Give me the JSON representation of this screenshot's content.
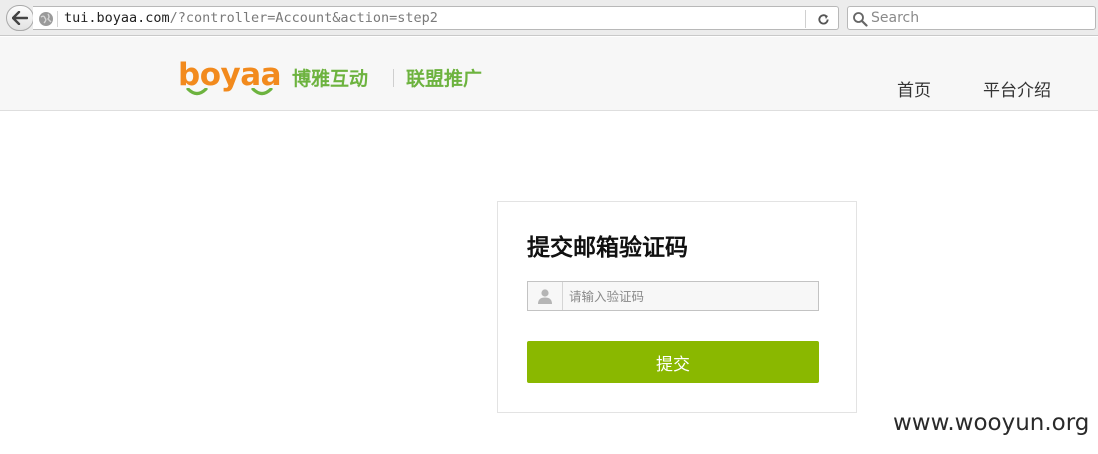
{
  "browser": {
    "url_host": "tui.boyaa.com",
    "url_path": "/?controller=Account&action=step2",
    "search_placeholder": "Search"
  },
  "header": {
    "logo_word": "boyaa",
    "logo_cn": "博雅互动",
    "logo_sub": "联盟推广",
    "nav": [
      "首页",
      "平台介绍"
    ]
  },
  "form": {
    "title": "提交邮箱验证码",
    "input_placeholder": "请输入验证码",
    "submit_label": "提交"
  },
  "watermark": "www.wooyun.org",
  "colors": {
    "brand_orange": "#f28a1d",
    "brand_green": "#6db33f",
    "button_green": "#8ab800"
  }
}
